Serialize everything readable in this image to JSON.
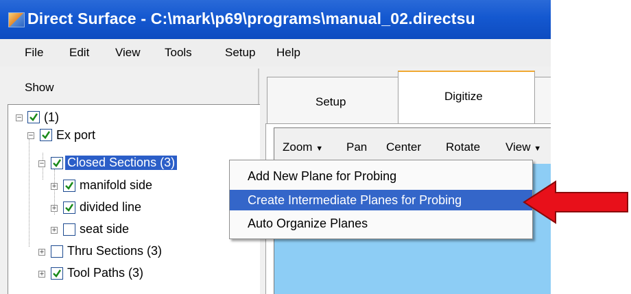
{
  "window": {
    "title": "Direct Surface - C:\\mark\\p69\\programs\\manual_02.directsu"
  },
  "menu": [
    "File",
    "Edit",
    "View",
    "Tools",
    "Setup",
    "Help"
  ],
  "left_panel": {
    "label": "Show"
  },
  "tree": [
    {
      "label": "(1)",
      "checked": true
    },
    {
      "label": "Ex port",
      "checked": true
    },
    {
      "label": "Closed Sections (3)",
      "checked": true,
      "selected": true
    },
    {
      "label": "manifold side",
      "checked": true
    },
    {
      "label": "divided line",
      "checked": true
    },
    {
      "label": "seat side",
      "checked": false
    },
    {
      "label": "Thru Sections (3)",
      "checked": false
    },
    {
      "label": "Tool Paths (3)",
      "checked": true
    }
  ],
  "tabs": [
    {
      "label": "Setup"
    },
    {
      "label": "Digitize",
      "active": true
    }
  ],
  "toolbar": {
    "zoom": "Zoom",
    "pan": "Pan",
    "center": "Center",
    "rotate": "Rotate",
    "view": "View"
  },
  "context_menu": [
    {
      "label": "Add New Plane for Probing"
    },
    {
      "label": "Create Intermediate Planes for Probing",
      "highlighted": true
    },
    {
      "label": "Auto Organize Planes"
    }
  ],
  "colors": {
    "titlebar": "#1458d0",
    "selection": "#2b5ec8",
    "menu_highlight": "#3466c9",
    "viewport": "#8dcdf5",
    "arrow": "#e8101a"
  },
  "icons": {
    "checkbox": "checkmark-icon",
    "expander": "plus-minus-icon",
    "pointer": "red-arrow-icon"
  }
}
